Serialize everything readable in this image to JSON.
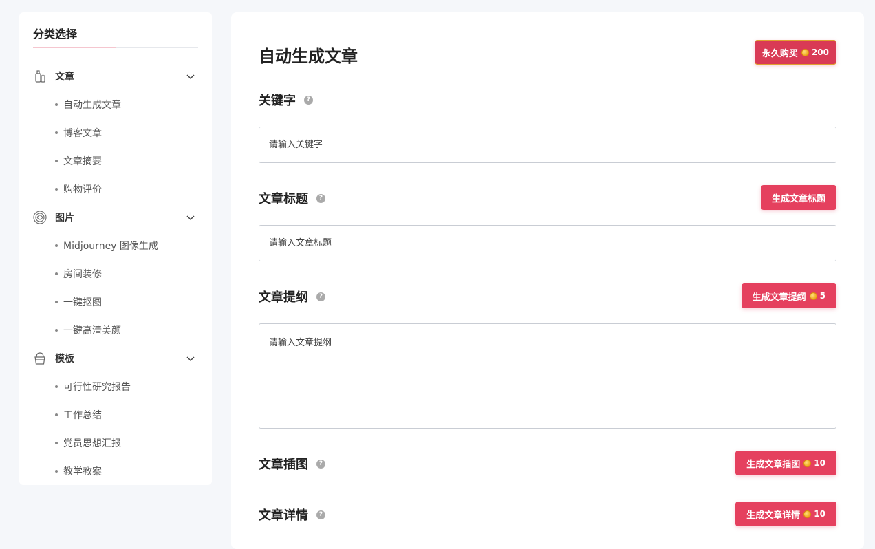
{
  "sidebar": {
    "title": "分类选择",
    "categories": [
      {
        "label": "文章",
        "icon": "bottle-icon",
        "items": [
          "自动生成文章",
          "博客文章",
          "文章摘要",
          "购物评价"
        ]
      },
      {
        "label": "图片",
        "icon": "swirl-icon",
        "items": [
          "Midjourney 图像生成",
          "房间装修",
          "一键抠图",
          "一键高清美颜"
        ]
      },
      {
        "label": "模板",
        "icon": "basket-icon",
        "items": [
          "可行性研究报告",
          "工作总结",
          "党员思想汇报",
          "教学教案"
        ]
      }
    ]
  },
  "main": {
    "title": "自动生成文章",
    "buy_button": {
      "label": "永久购买",
      "cost": "200"
    },
    "sections": {
      "keyword": {
        "label": "关键字",
        "placeholder": "请输入关键字"
      },
      "title": {
        "label": "文章标题",
        "placeholder": "请输入文章标题",
        "button": "生成文章标题"
      },
      "outline": {
        "label": "文章提纲",
        "placeholder": "请输入文章提纲",
        "button": "生成文章提纲",
        "cost": "5"
      },
      "illustration": {
        "label": "文章插图",
        "button": "生成文章插图",
        "cost": "10"
      },
      "detail": {
        "label": "文章详情",
        "button": "生成文章详情",
        "cost": "10"
      }
    },
    "help_glyph": "?"
  },
  "colors": {
    "accent": "#e5405e",
    "background": "#f5f7fa",
    "coin": "#f0a51d"
  }
}
